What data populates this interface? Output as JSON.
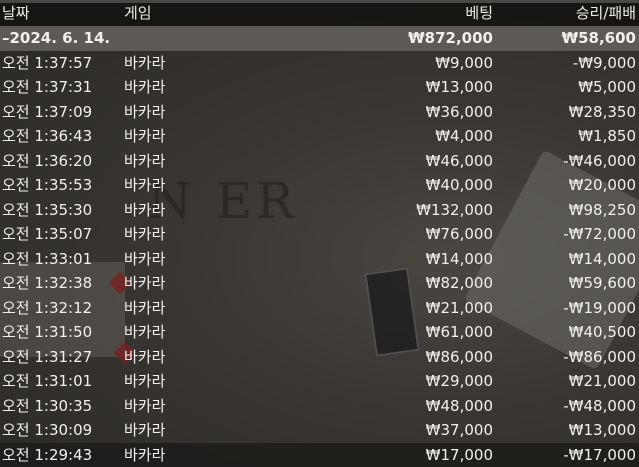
{
  "headers": {
    "date": "날짜",
    "game": "게임",
    "bet": "베팅",
    "result": "승리/패배"
  },
  "summary": {
    "date": "–2024. 6. 14.",
    "bet": "₩872,000",
    "result": "₩58,600"
  },
  "background": {
    "watermark": "N ER"
  },
  "rows": [
    {
      "time": "오전 1:37:57",
      "game": "바카라",
      "bet": "₩9,000",
      "result": "-₩9,000"
    },
    {
      "time": "오전 1:37:31",
      "game": "바카라",
      "bet": "₩13,000",
      "result": "₩5,000"
    },
    {
      "time": "오전 1:37:09",
      "game": "바카라",
      "bet": "₩36,000",
      "result": "₩28,350"
    },
    {
      "time": "오전 1:36:43",
      "game": "바카라",
      "bet": "₩4,000",
      "result": "₩1,850"
    },
    {
      "time": "오전 1:36:20",
      "game": "바카라",
      "bet": "₩46,000",
      "result": "-₩46,000"
    },
    {
      "time": "오전 1:35:53",
      "game": "바카라",
      "bet": "₩40,000",
      "result": "₩20,000"
    },
    {
      "time": "오전 1:35:30",
      "game": "바카라",
      "bet": "₩132,000",
      "result": "₩98,250"
    },
    {
      "time": "오전 1:35:07",
      "game": "바카라",
      "bet": "₩76,000",
      "result": "-₩72,000"
    },
    {
      "time": "오전 1:33:01",
      "game": "바카라",
      "bet": "₩14,000",
      "result": "₩14,000"
    },
    {
      "time": "오전 1:32:38",
      "game": "바카라",
      "bet": "₩82,000",
      "result": "₩59,600"
    },
    {
      "time": "오전 1:32:12",
      "game": "바카라",
      "bet": "₩21,000",
      "result": "-₩19,000"
    },
    {
      "time": "오전 1:31:50",
      "game": "바카라",
      "bet": "₩61,000",
      "result": "₩40,500"
    },
    {
      "time": "오전 1:31:27",
      "game": "바카라",
      "bet": "₩86,000",
      "result": "-₩86,000"
    },
    {
      "time": "오전 1:31:01",
      "game": "바카라",
      "bet": "₩29,000",
      "result": "₩21,000"
    },
    {
      "time": "오전 1:30:35",
      "game": "바카라",
      "bet": "₩48,000",
      "result": "-₩48,000"
    },
    {
      "time": "오전 1:30:09",
      "game": "바카라",
      "bet": "₩37,000",
      "result": "₩13,000"
    },
    {
      "time": "오전 1:29:43",
      "game": "바카라",
      "bet": "₩17,000",
      "result": "-₩17,000"
    }
  ],
  "colors": {
    "header_bg": "#141311",
    "date_row_bg": "#5f5c58",
    "text": "#f2f0ec"
  }
}
